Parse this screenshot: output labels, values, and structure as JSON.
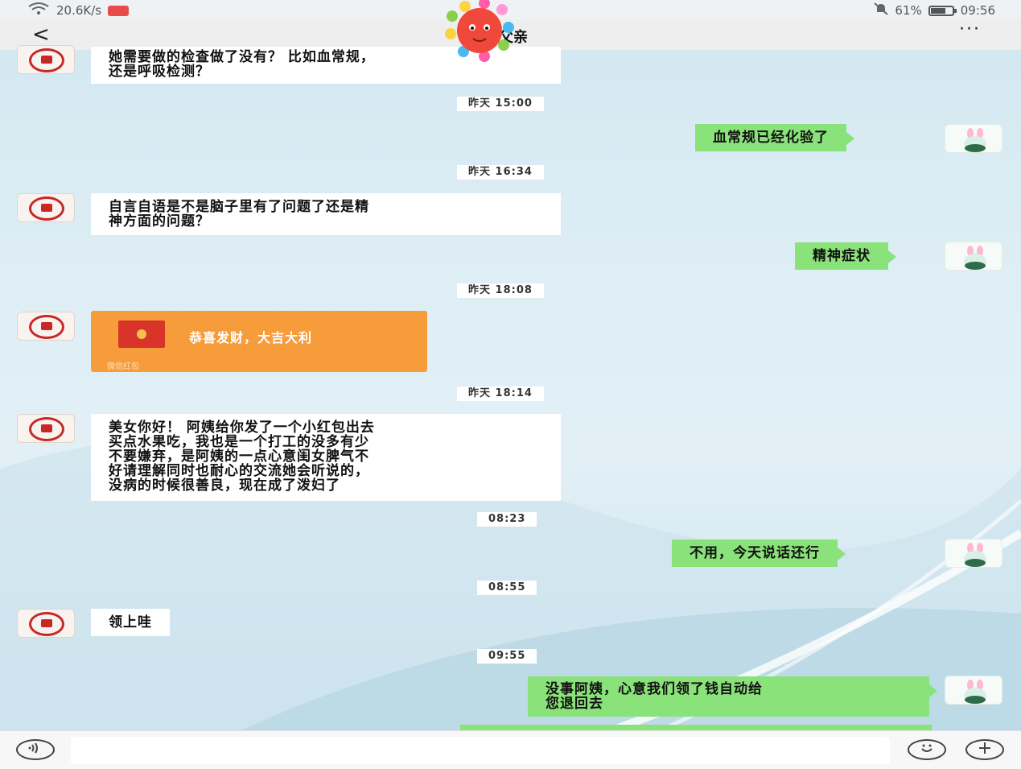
{
  "status_bar": {
    "network_speed": "20.6K/s",
    "battery": "61%",
    "time": "09:56"
  },
  "header": {
    "back_icon": "<",
    "title": "父亲",
    "more_icon": "···"
  },
  "messages": [
    {
      "type": "text",
      "dir": "in",
      "text": "她需要做的检查做了没有？ 比如血常规，\n还是呼吸检测？"
    },
    {
      "type": "timestamp",
      "text": "昨天 15:00"
    },
    {
      "type": "text",
      "dir": "out",
      "text": "血常规已经化验了"
    },
    {
      "type": "timestamp",
      "text": "昨天 16:34"
    },
    {
      "type": "text",
      "dir": "in",
      "text": "自言自语是不是脑子里有了问题了还是精\n神方面的问题？"
    },
    {
      "type": "text",
      "dir": "out",
      "text": "精神症状"
    },
    {
      "type": "timestamp",
      "text": "昨天 18:08"
    },
    {
      "type": "red_packet",
      "dir": "in",
      "text": "恭喜发财，大吉大利",
      "label": "微信红包"
    },
    {
      "type": "timestamp",
      "text": "昨天 18:14"
    },
    {
      "type": "text",
      "dir": "in",
      "text": "美女你好！ 阿姨给你发了一个小红包出去\n买点水果吃，我也是一个打工的没多有少\n不要嫌弃，是阿姨的一点心意闺女脾气不\n好请理解同时也耐心的交流她会听说的，\n没病的时候很善良，现在成了泼妇了"
    },
    {
      "type": "timestamp",
      "text": "08:23"
    },
    {
      "type": "text",
      "dir": "out",
      "text": "不用，今天说话还行"
    },
    {
      "type": "timestamp",
      "text": "08:55"
    },
    {
      "type": "text",
      "dir": "in",
      "text": "领上哇"
    },
    {
      "type": "timestamp",
      "text": "09:55"
    },
    {
      "type": "text",
      "dir": "out",
      "text": "没事阿姨，心意我们领了钱自动给\n您退回去"
    }
  ],
  "input_bar": {
    "voice_icon": "voice-icon",
    "emoji_icon": "emoji-icon",
    "plus_icon": "plus-icon"
  },
  "colors": {
    "outgoing_bubble": "#8ae27a",
    "incoming_bubble": "#ffffff",
    "red_packet": "#f79c3a"
  }
}
